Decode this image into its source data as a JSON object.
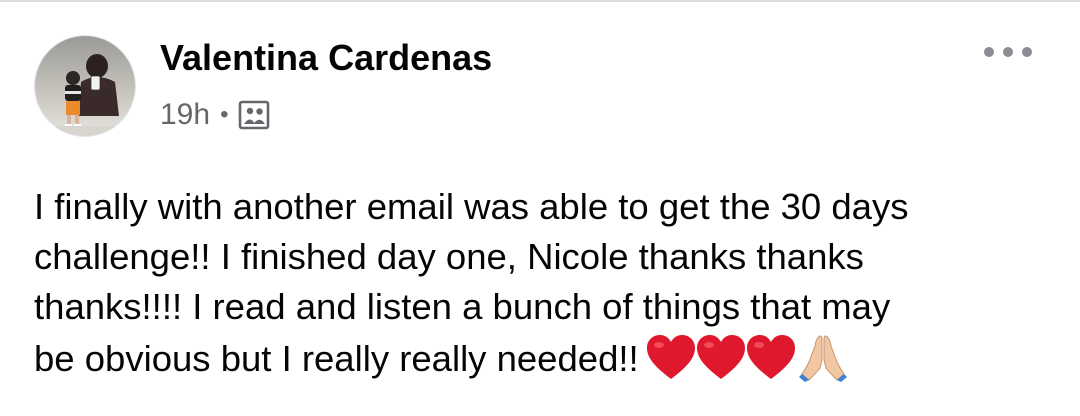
{
  "post": {
    "author": "Valentina Cardenas",
    "timestamp": "19h",
    "separator": "•",
    "audience_icon": "photo-gallery-icon",
    "more_icon": "more-horizontal-icon",
    "body_lines": [
      "I finally with another email was able to get the 30 days",
      "challenge!! I finished day one, Nicole thanks thanks",
      "thanks!!!! I read and listen a bunch of things that may",
      "be obvious but I really really needed!!"
    ],
    "emojis": [
      "red-heart-icon",
      "red-heart-icon",
      "red-heart-icon",
      "folded-hands-icon"
    ]
  },
  "colors": {
    "text_primary": "#050505",
    "text_secondary": "#65676b",
    "heart": "#e0182d",
    "divider": "#dcdcdc"
  }
}
